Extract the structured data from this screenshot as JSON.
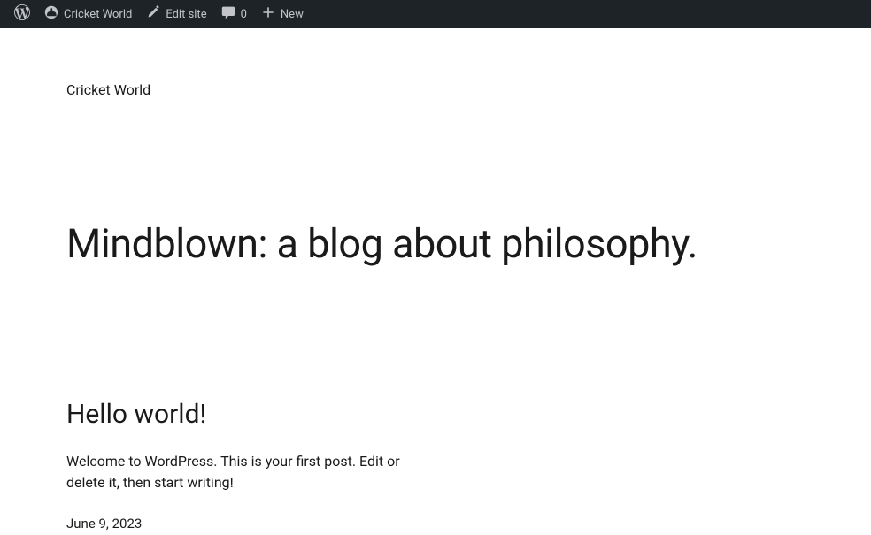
{
  "adminBar": {
    "siteName": "Cricket World",
    "editSite": "Edit site",
    "commentCount": "0",
    "newLabel": "New"
  },
  "site": {
    "title": "Cricket World"
  },
  "page": {
    "heading": "Mindblown: a blog about philosophy."
  },
  "post": {
    "title": "Hello world!",
    "excerpt": "Welcome to WordPress. This is your first post. Edit or delete it, then start writing!",
    "date": "June 9, 2023"
  }
}
